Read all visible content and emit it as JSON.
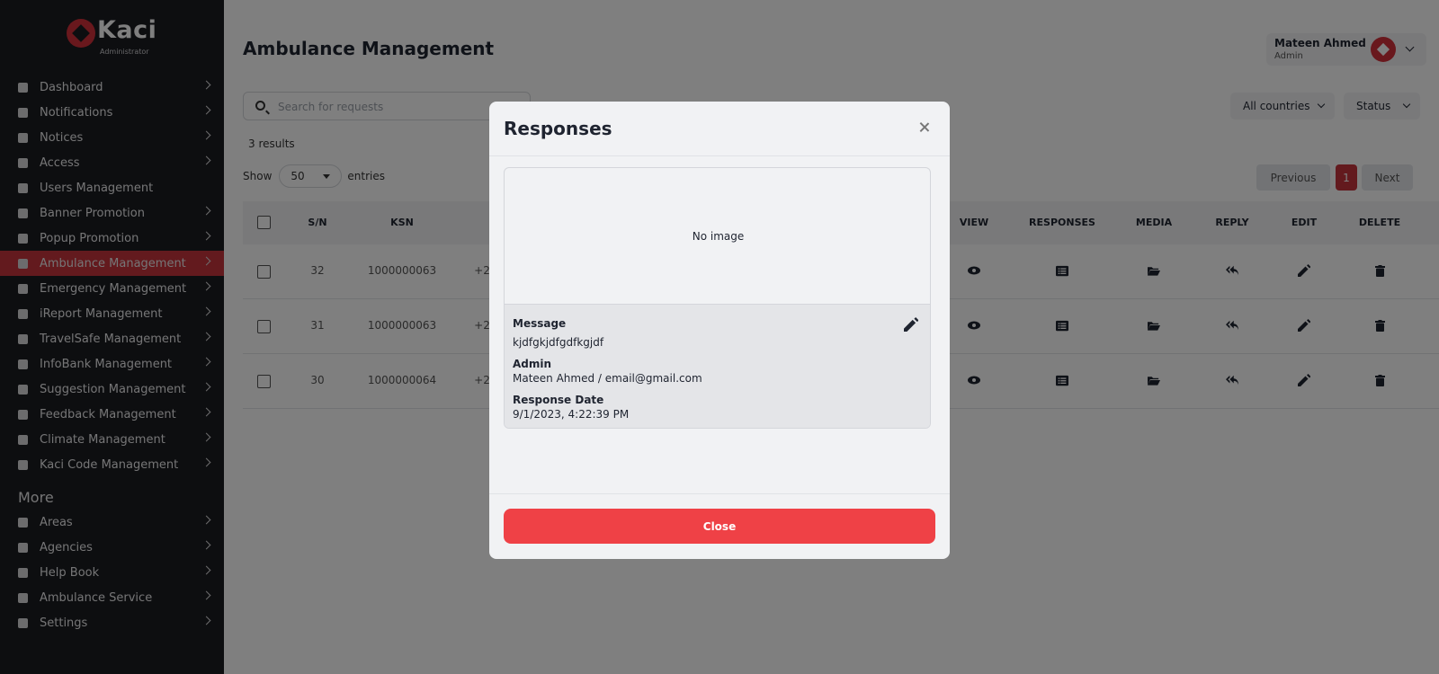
{
  "sidebar": {
    "brand": "Kaci",
    "brand_sub": "Administrator",
    "items": [
      {
        "label": "Dashboard",
        "icon": "dashboard-icon"
      },
      {
        "label": "Notifications",
        "icon": "bell-icon"
      },
      {
        "label": "Notices",
        "icon": "notice-icon"
      },
      {
        "label": "Access",
        "icon": "lock-icon"
      },
      {
        "label": "Users Management",
        "icon": "user-icon"
      },
      {
        "label": "Banner Promotion",
        "icon": "banner-icon"
      },
      {
        "label": "Popup Promotion",
        "icon": "popup-icon"
      },
      {
        "label": "Ambulance Management",
        "icon": "ambulance-icon",
        "active": true
      },
      {
        "label": "Emergency Management",
        "icon": "emergency-icon"
      },
      {
        "label": "iReport Management",
        "icon": "report-icon"
      },
      {
        "label": "TravelSafe Management",
        "icon": "travel-icon"
      },
      {
        "label": "InfoBank Management",
        "icon": "info-icon"
      },
      {
        "label": "Suggestion Management",
        "icon": "suggestion-icon"
      },
      {
        "label": "Feedback Management",
        "icon": "feedback-icon"
      },
      {
        "label": "Climate Management",
        "icon": "globe-icon"
      },
      {
        "label": "Kaci Code Management",
        "icon": "code-icon"
      }
    ],
    "more_title": "More",
    "more_items": [
      {
        "label": "Areas",
        "icon": "map-icon"
      },
      {
        "label": "Agencies",
        "icon": "building-icon"
      },
      {
        "label": "Help Book",
        "icon": "group-icon"
      },
      {
        "label": "Ambulance Service",
        "icon": "ambulance-icon"
      },
      {
        "label": "Settings",
        "icon": "gear-icon"
      }
    ]
  },
  "header": {
    "title": "Ambulance Management",
    "user_name": "Mateen Ahmed",
    "user_role": "Admin"
  },
  "toolbar": {
    "search_placeholder": "Search for requests",
    "filter_countries": "All countries",
    "filter_status": "Status",
    "results": "3 results",
    "show_label": "Show",
    "show_value": "50",
    "entries_label": "entries",
    "prev": "Previous",
    "page": "1",
    "next": "Next"
  },
  "table": {
    "headers": [
      "S/N",
      "KSN",
      "VIEW",
      "RESPONSES",
      "MEDIA",
      "REPLY",
      "EDIT",
      "DELETE"
    ],
    "rows": [
      {
        "sn": "32",
        "ksn": "1000000063",
        "phone": "+2"
      },
      {
        "sn": "31",
        "ksn": "1000000063",
        "phone": "+2"
      },
      {
        "sn": "30",
        "ksn": "1000000064",
        "phone": "+2"
      }
    ]
  },
  "modal": {
    "title": "Responses",
    "no_image": "No image",
    "message_label": "Message",
    "message_value": "kjdfgkjdfgdfkgjdf",
    "admin_label": "Admin",
    "admin_value": "Mateen Ahmed / email@gmail.com",
    "date_label": "Response Date",
    "date_value": "9/1/2023, 4:22:39 PM",
    "close_label": "Close"
  },
  "colors": {
    "sidebar_bg": "#1b1c20",
    "accent": "#c7343c",
    "close_button": "#ef4146"
  }
}
